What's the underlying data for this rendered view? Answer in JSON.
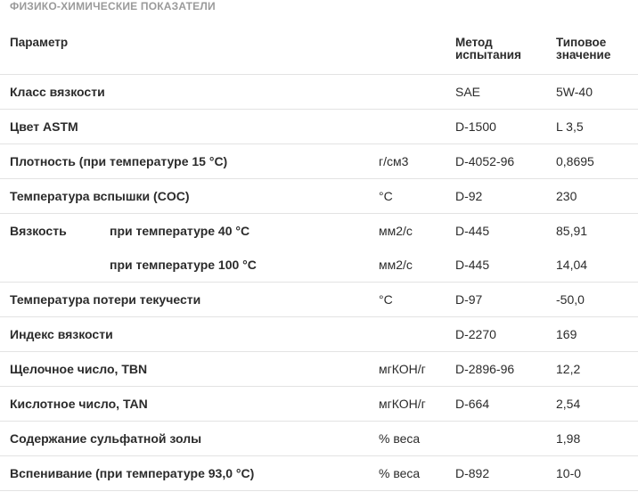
{
  "section_title": "ФИЗИКО-ХИМИЧЕСКИЕ ПОКАЗАТЕЛИ",
  "headers": {
    "param": "Параметр",
    "method_line1": "Метод",
    "method_line2": "испытания",
    "value_line1": "Типовое",
    "value_line2": "значение"
  },
  "rows": [
    {
      "param": "Класс вязкости",
      "sub": "",
      "unit": "",
      "method": "SAE",
      "value": "5W-40"
    },
    {
      "param": "Цвет ASTM",
      "sub": "",
      "unit": "",
      "method": "D-1500",
      "value": "L 3,5"
    },
    {
      "param": "Плотность (при температуре 15 °С)",
      "sub": "",
      "unit": "г/см3",
      "method": "D-4052-96",
      "value": "0,8695"
    },
    {
      "param": "Температура вспышки (COC)",
      "sub": "",
      "unit": "°С",
      "method": "D-92",
      "value": "230"
    },
    {
      "param": "Вязкость",
      "sub": "при температуре 40 °С",
      "unit": "мм2/с",
      "method": "D-445",
      "value": "85,91"
    },
    {
      "param": "",
      "sub": "при температуре 100 °С",
      "unit": "мм2/с",
      "method": "D-445",
      "value": "14,04"
    },
    {
      "param": "Температура потери текучести",
      "sub": "",
      "unit": "°С",
      "method": "D-97",
      "value": "-50,0"
    },
    {
      "param": "Индекс вязкости",
      "sub": "",
      "unit": "",
      "method": "D-2270",
      "value": "169"
    },
    {
      "param": "Щелочное число, TBN",
      "sub": "",
      "unit": "мгКОН/г",
      "method": "D-2896-96",
      "value": "12,2"
    },
    {
      "param": "Кислотное число, TAN",
      "sub": "",
      "unit": "мгКОН/г",
      "method": "D-664",
      "value": "2,54"
    },
    {
      "param": "Содержание сульфатной золы",
      "sub": "",
      "unit": "% веса",
      "method": "",
      "value": "1,98"
    },
    {
      "param": "Вспенивание (при температуре 93,0 °С)",
      "sub": "",
      "unit": "% веса",
      "method": "D-892",
      "value": "10-0"
    }
  ]
}
